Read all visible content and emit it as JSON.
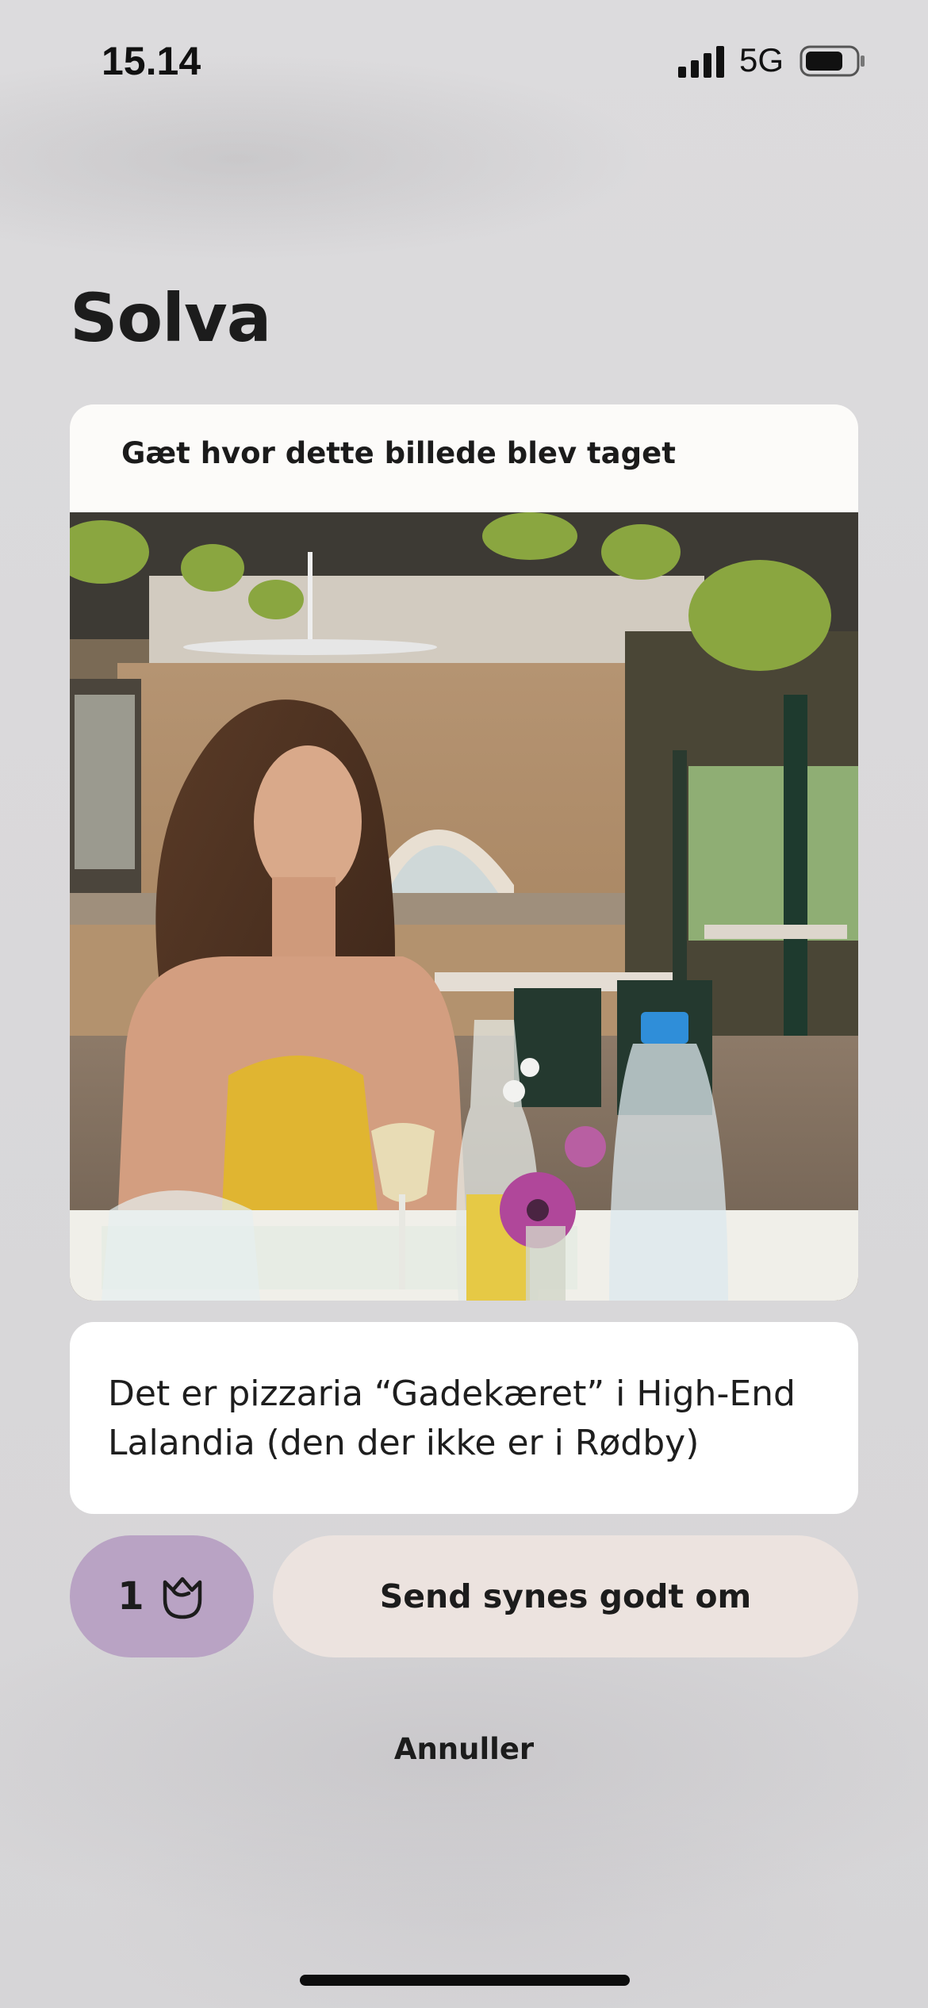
{
  "status_bar": {
    "time": "15.14",
    "network": "5G",
    "icons": [
      "signal-icon",
      "battery-icon"
    ]
  },
  "profile": {
    "name": "Solva"
  },
  "prompt_card": {
    "prompt": "Gæt hvor dette billede blev taget",
    "photo_icon": "photo"
  },
  "comment": {
    "text": "Det er pizzaria “Gadekæret” i High-End Lalandia (den der ikke er i Rødby)"
  },
  "actions": {
    "rose_count": "1",
    "rose_icon": "rose-icon",
    "send_label": "Send synes godt om",
    "cancel_label": "Annuller"
  },
  "colors": {
    "background": "#d9d8da",
    "rose_button": "#b9a3c4",
    "send_button": "#ece3df",
    "card": "#ffffff"
  }
}
